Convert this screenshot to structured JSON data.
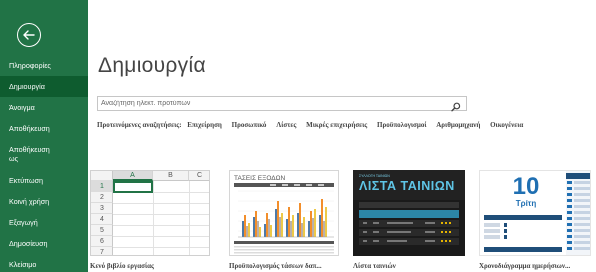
{
  "sidebar": {
    "back_label": "Πίσω",
    "items": [
      {
        "label": "Πληροφορίες",
        "active": false
      },
      {
        "label": "Δημιουργία",
        "active": true
      },
      {
        "label": "Άνοιγμα",
        "active": false
      },
      {
        "label": "Αποθήκευση",
        "active": false
      },
      {
        "label": "Αποθήκευση ως",
        "active": false
      },
      {
        "label": "Εκτύπωση",
        "active": false
      },
      {
        "label": "Κοινή χρήση",
        "active": false
      },
      {
        "label": "Εξαγωγή",
        "active": false
      },
      {
        "label": "Δημοσίευση",
        "active": false
      },
      {
        "label": "Κλείσιμο",
        "active": false
      }
    ]
  },
  "main": {
    "title": "Δημιουργία",
    "search": {
      "placeholder": "Αναζήτηση ηλεκτ. προτύπων",
      "value": ""
    },
    "suggested": {
      "label": "Προτεινόμενες αναζητήσεις:",
      "links": [
        "Επιχείρηση",
        "Προσωπικό",
        "Λίστες",
        "Μικρές επιχειρήσεις",
        "Προϋπολογισμοί",
        "Αριθμομηχανή",
        "Οικογένεια"
      ]
    },
    "templates": [
      {
        "title": "Κενό βιβλίο εργασίας",
        "columns": [
          "A",
          "B",
          "C"
        ],
        "rows": [
          "1",
          "2",
          "3",
          "4",
          "5",
          "6",
          "7"
        ]
      },
      {
        "title": "Προϋπολογισμός τάσεων δαπ...",
        "chart_title": "ΤΑΣΕΙΣ ΕΞΟΔΩΝ"
      },
      {
        "title": "Λίστα ταινιών",
        "kicker": "ΣΥΛΛΟΓΗ ΤΑΙΝΙΩΝ",
        "heading": "ΛΙΣΤΑ ΤΑΙΝΙΩΝ"
      },
      {
        "title": "Χρονοδιάγραμμα ημερήσιων...",
        "day_number": "10",
        "day_name": "Τρίτη"
      }
    ]
  },
  "colors": {
    "sidebar": "#217346",
    "sidebar_active": "#0e5c2f",
    "accent_blue": "#1f6fb2"
  }
}
